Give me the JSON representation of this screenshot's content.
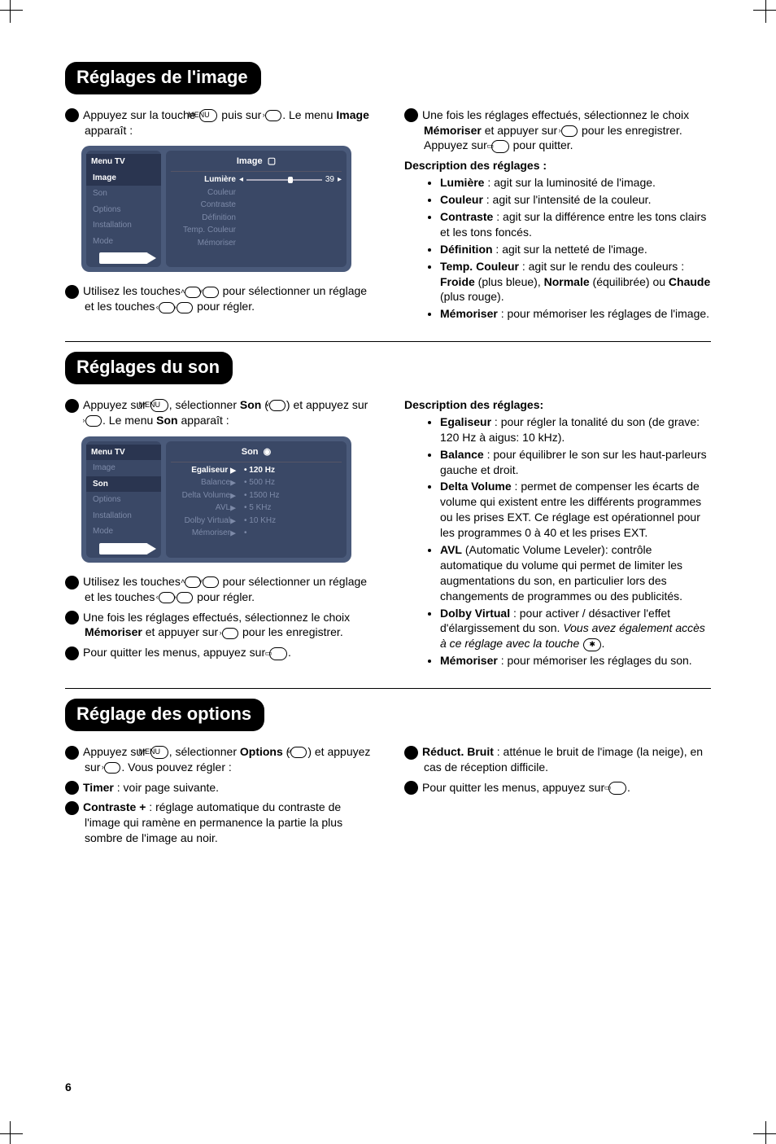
{
  "page_number": "6",
  "sections": {
    "image": {
      "title": "Réglages de l'image",
      "steps": {
        "s1a": "Appuyez sur la touche ",
        "s1b": " puis sur ",
        "s1c": ". Le menu ",
        "s1menu": "Image",
        "s1d": " apparaît :",
        "s2a": "Utilisez les touches ",
        "s2b": " pour sélectionner un réglage et les touches ",
        "s2c": " pour régler.",
        "s3a": "Une fois les réglages effectués, sélectionnez le choix ",
        "s3mem": "Mémoriser",
        "s3b": " et appuyer sur ",
        "s3c": " pour les enregistrer. Appuyez sur ",
        "s3d": " pour quitter."
      },
      "desc_head": "Description des réglages :",
      "items": {
        "lum_b": "Lumière",
        "lum_t": " : agit sur la luminosité de l'image.",
        "cou_b": "Couleur",
        "cou_t": " : agit sur l'intensité de la couleur.",
        "con_b": "Contraste",
        "con_t": " : agit sur la différence entre les tons clairs et les tons foncés.",
        "def_b": "Définition",
        "def_t": " : agit sur la netteté de l'image.",
        "tmp_b": "Temp. Couleur",
        "tmp_t": " : agit sur le rendu des couleurs : ",
        "tmp_froide": "Froide",
        "tmp_froide_t": " (plus bleue), ",
        "tmp_norm": "Normale",
        "tmp_norm_t": " (équilibrée) ou ",
        "tmp_chaude": "Chaude",
        "tmp_chaude_t": " (plus rouge).",
        "mem_b": "Mémoriser",
        "mem_t": " : pour mémoriser les réglages de l'image."
      },
      "osd": {
        "left_title": "Menu TV",
        "left_items": [
          "Image",
          "Son",
          "Options",
          "Installation",
          "Mode"
        ],
        "right_title": "Image",
        "rows": [
          "Lumière",
          "Couleur",
          "Contraste",
          "Définition",
          "Temp. Couleur",
          "Mémoriser"
        ],
        "slider_val": "39"
      }
    },
    "sound": {
      "title": "Réglages du son",
      "steps": {
        "s1a": "Appuyez sur ",
        "s1b": ", sélectionner ",
        "s1son": "Son",
        "s1c": " (",
        "s1d": ") et appuyez sur ",
        "s1e": ". Le menu ",
        "s1f": " apparaît :",
        "s2a": "Utilisez les touches ",
        "s2b": " pour sélectionner un réglage et les touches ",
        "s2c": " pour régler.",
        "s3a": "Une fois les réglages effectués, sélectionnez le choix ",
        "s3mem": "Mémoriser",
        "s3b": " et appuyer sur ",
        "s3c": " pour les enregistrer.",
        "s4a": "Pour quitter les menus, appuyez sur ",
        "s4b": "."
      },
      "desc_head": "Description des réglages:",
      "items": {
        "eg_b": "Egaliseur",
        "eg_t": " : pour régler la tonalité du son (de grave: 120 Hz à aigus: 10 kHz).",
        "bal_b": "Balance",
        "bal_t": " : pour équilibrer le son sur les haut-parleurs gauche et droit.",
        "dv_b": "Delta Volume",
        "dv_t": " : permet de compenser les écarts de volume qui existent entre les différents programmes ou les prises EXT. Ce réglage est opérationnel pour les programmes 0 à 40 et les prises EXT.",
        "avl_b": "AVL",
        "avl_t": "  (Automatic Volume Leveler): contrôle automatique du volume qui permet de limiter les augmentations du son, en particulier lors des changements de programmes ou des publicités.",
        "do_b": "Dolby Virtual",
        "do_t": " : pour activer / désactiver l'effet d'élargissement du son. ",
        "do_i": "Vous avez également accès à ce réglage avec la touche ",
        "do_i2": ".",
        "mem_b": "Mémoriser",
        "mem_t": " : pour mémoriser les réglages du son."
      },
      "osd": {
        "left_title": "Menu TV",
        "left_items": [
          "Image",
          "Son",
          "Options",
          "Installation",
          "Mode"
        ],
        "right_title": "Son",
        "left_labels": [
          "Egaliseur",
          "Balance",
          "Delta Volume",
          "AVL",
          "Dolby Virtual",
          "Mémoriser"
        ],
        "right_vals": [
          "120 Hz",
          "500 Hz",
          "1500 Hz",
          "5 KHz",
          "10 KHz",
          ""
        ]
      }
    },
    "options": {
      "title": "Réglage des options",
      "steps": {
        "s1a": "Appuyez sur ",
        "s1b": ", sélectionner ",
        "s1opt": "Options",
        "s1c": " (",
        "s1d": ") et appuyez sur ",
        "s1e": ". Vous pouvez régler :",
        "s2b": "Timer",
        "s2t": " : voir page suivante.",
        "s3b": "Contraste +",
        "s3t": " : réglage automatique du contraste de l'image qui ramène en permanence la partie la plus sombre de l'image au noir.",
        "s4b": "Réduct. Bruit",
        "s4t": " : atténue le bruit de l'image (la neige), en cas de réception difficile.",
        "s5a": "Pour quitter les menus, appuyez sur ",
        "s5b": "."
      }
    }
  },
  "icons": {
    "menu": "MENU",
    "right": "›",
    "left": "‹",
    "up": "˄",
    "down": "˅",
    "exit": "▭",
    "surround": "✱"
  }
}
